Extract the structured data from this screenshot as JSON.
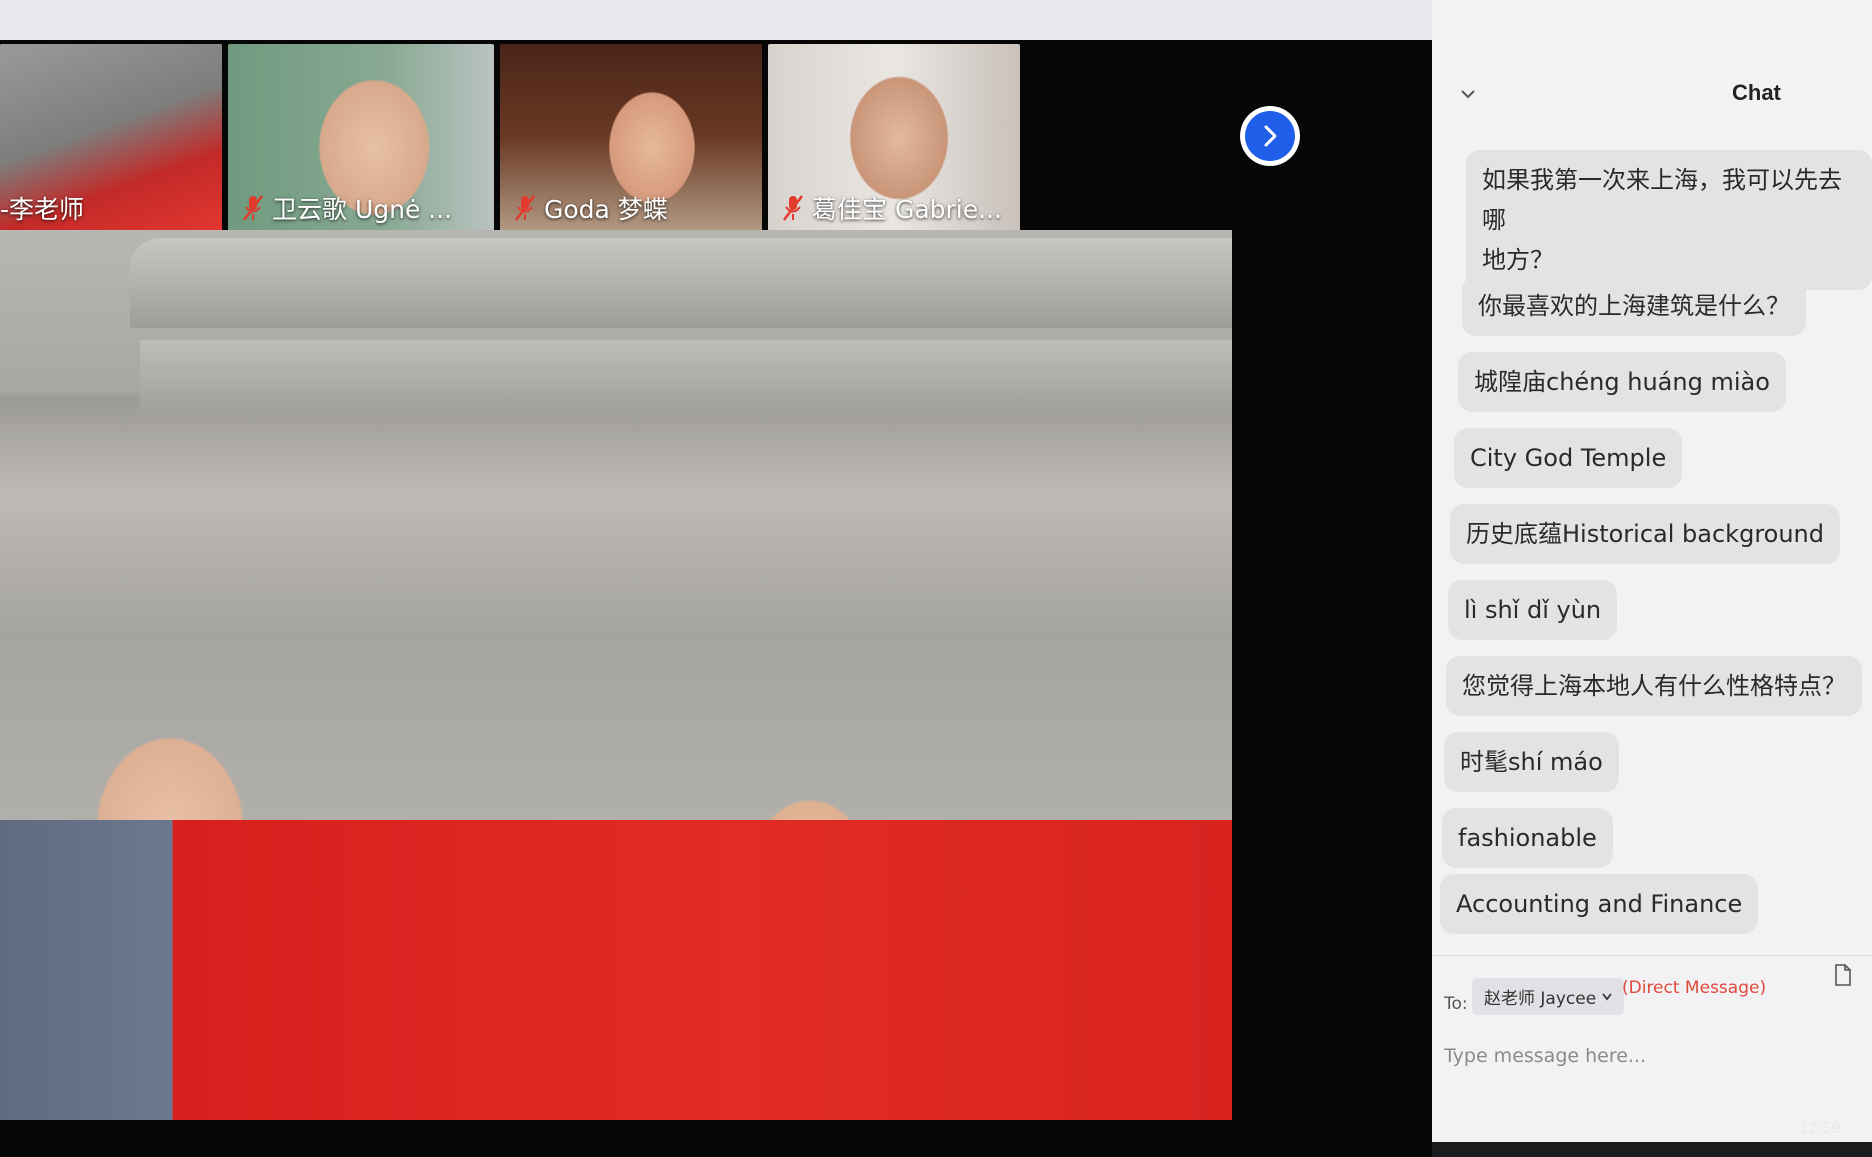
{
  "app": {
    "chat_title": "Chat"
  },
  "participants": [
    {
      "name": "-李老师",
      "muted": false,
      "active": true
    },
    {
      "name": "卫云歌 Ugnė ...",
      "muted": true,
      "active": false
    },
    {
      "name": "Goda 梦蝶",
      "muted": true,
      "active": false
    },
    {
      "name": "葛佳宝 Gabrie...",
      "muted": true,
      "active": false
    }
  ],
  "chat": {
    "messages": [
      {
        "text": "如果我第一次来上海，我可以先去哪",
        "text2": "地方？"
      },
      {
        "text": "你最喜欢的上海建筑是什么？"
      },
      {
        "text": "城隍庙chéng huáng miào"
      },
      {
        "text": "City God Temple"
      },
      {
        "text": "历史底蕴Historical background"
      },
      {
        "text": "lì shǐ dǐ yùn"
      },
      {
        "text": "您觉得上海本地人有什么性格特点？"
      },
      {
        "text": "时髦shí máo"
      },
      {
        "text": "fashionable"
      },
      {
        "text": "Accounting and Finance"
      }
    ],
    "compose": {
      "to_label": "To:",
      "recipient": "赵老师 Jaycee",
      "direct_message_label": "(Direct Message)",
      "placeholder": "Type message here..."
    }
  },
  "system": {
    "time": "12:59"
  },
  "colors": {
    "active_border": "#b7d35a",
    "accent_blue": "#1f5ee8",
    "direct_message": "#e0493b",
    "mute_red": "#e23b2e"
  }
}
